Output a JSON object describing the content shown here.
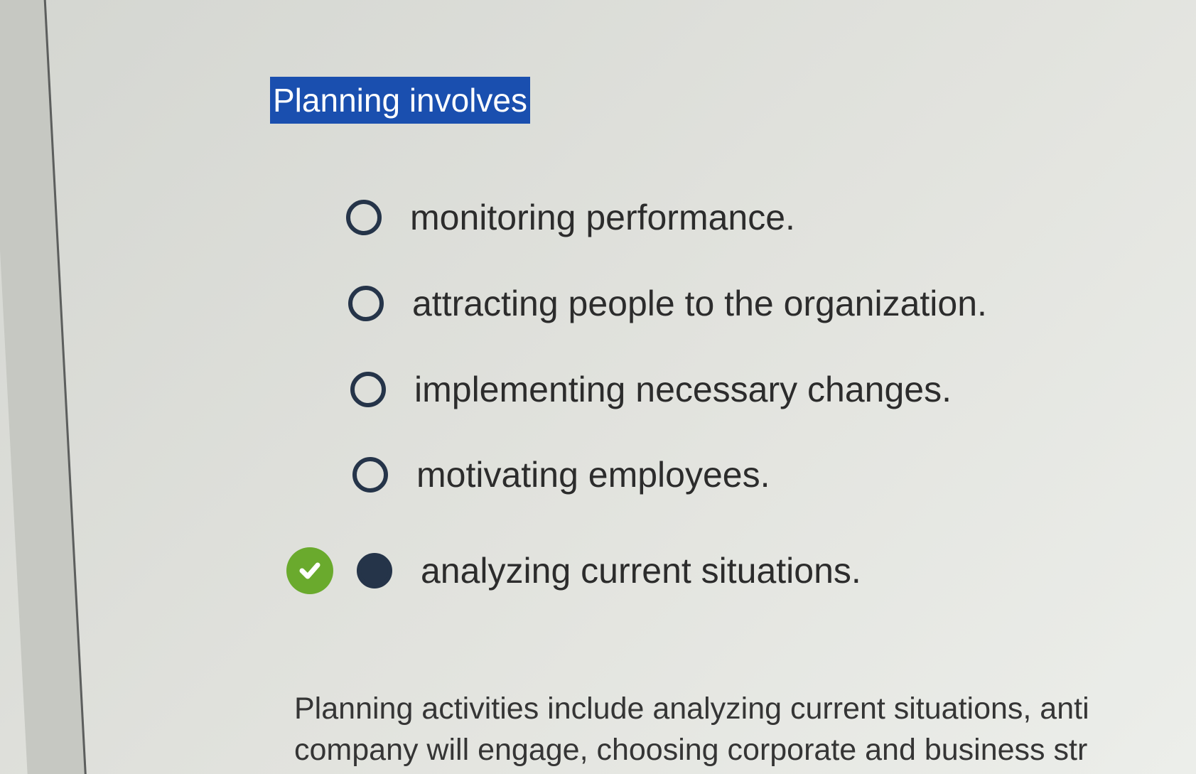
{
  "question": {
    "text": "Planning involves"
  },
  "options": [
    {
      "label": "monitoring performance.",
      "selected": false
    },
    {
      "label": "attracting people to the organization.",
      "selected": false
    },
    {
      "label": "implementing necessary changes.",
      "selected": false
    },
    {
      "label": "motivating employees.",
      "selected": false
    },
    {
      "label": "analyzing current situations.",
      "selected": true,
      "correct": true
    }
  ],
  "explanation": {
    "line1": "Planning activities include analyzing current situations, anti",
    "line2": "company will engage, choosing corporate and business str"
  },
  "colors": {
    "highlight": "#1a4faf",
    "radio": "#253449",
    "correct": "#6aaa2d"
  },
  "icons": {
    "correct": "checkmark-icon"
  }
}
